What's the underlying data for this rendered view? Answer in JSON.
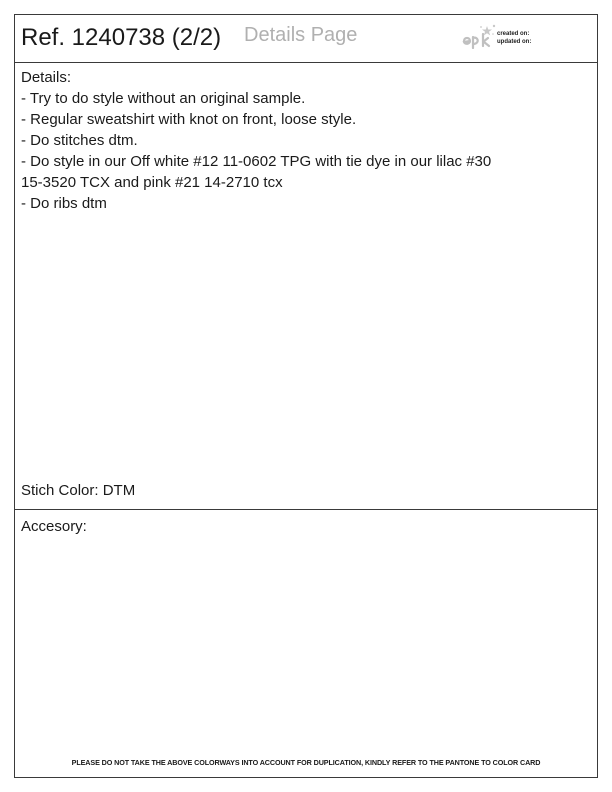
{
  "header": {
    "ref_title": "Ref. 1240738 (2/2)",
    "page_label": "Details Page",
    "logo_name": "epk-logo-icon",
    "created_label": "created on:",
    "updated_label": "updated on:"
  },
  "details": {
    "lines": [
      "Details:",
      "- Try to do style without an original sample.",
      "- Regular sweatshirt with knot on front, loose style.",
      "- Do stitches dtm.",
      "- Do style in our Off white #12 11-0602 TPG with tie dye in our lilac #30",
      "15-3520 TCX and pink #21 14-2710 tcx",
      "- Do ribs dtm"
    ],
    "stitch_color": "Stich Color: DTM"
  },
  "accessory": {
    "label": "Accesory:"
  },
  "footer": {
    "note": "PLEASE DO NOT TAKE THE ABOVE COLORWAYS INTO ACCOUNT FOR DUPLICATION, KINDLY REFER TO THE PANTONE TO COLOR CARD"
  }
}
